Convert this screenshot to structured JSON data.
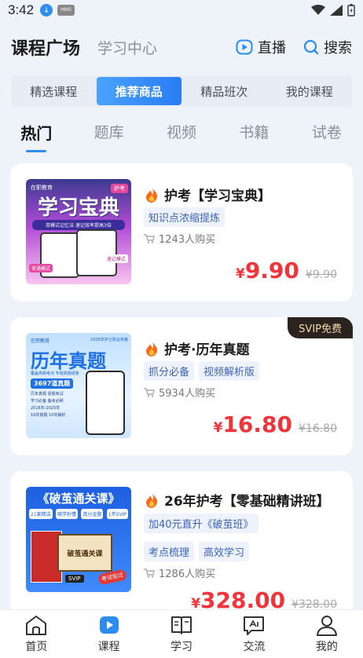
{
  "status": {
    "time": "3:42",
    "hms": "HMS"
  },
  "topbar": {
    "title": "课程广场",
    "subtitle": "学习中心",
    "live": "直播",
    "search": "搜索"
  },
  "segments": [
    "精选课程",
    "推荐商品",
    "精品班次",
    "我的课程"
  ],
  "active_segment": "推荐商品",
  "tabs": [
    "热门",
    "题库",
    "视频",
    "书籍",
    "试卷"
  ],
  "active_tab": "热门",
  "products": [
    {
      "title": "护考【学习宝典】",
      "tags": [
        "知识点浓缩提炼"
      ],
      "buyers": "1243人购买",
      "price_symbol": "¥",
      "price": "9.90",
      "original": "¥9.90",
      "cover": {
        "brand": "在职教育",
        "corner": "护考",
        "headline": "学习宝典",
        "ribbon": "双模式记忆法 速记效率提高3倍",
        "badge1": "背诵模式",
        "badge2": "速记模式"
      }
    },
    {
      "title": "护考·历年真题",
      "tags": [
        "抓分必备",
        "视频解析版"
      ],
      "buyers": "5934人购买",
      "price_symbol": "¥",
      "price": "16.80",
      "original": "¥16.80",
      "badge": "SVIP免费",
      "cover": {
        "brand": "在职教育",
        "top": "2026年护士执业资格",
        "headline": "历年真题",
        "sub": "覆盖高频考点 专题真题组卷",
        "count": "3697道真题",
        "lines": [
          "历年真题 逐题考试",
          "学习必备 备考必刷",
          "2016年-2025年",
          "10年真题 10年解析"
        ]
      }
    },
    {
      "title": "26年护考【零基础精讲班】",
      "tags": [
        "加40元直升《破茧班》",
        "考点梳理",
        "高效学习"
      ],
      "buyers": "1286人购买",
      "price_symbol": "¥",
      "price": "328.00",
      "original": "¥328.00",
      "cover": {
        "headline": "《破茧通关课》",
        "chips": [
          "21套精讲",
          "随学秒懂",
          "真分金题",
          "1年SVIP"
        ],
        "box": "破茧通关课",
        "svip": "SVIP",
        "stamp": "考试包过"
      }
    }
  ],
  "tabbar": [
    "首页",
    "课程",
    "学习",
    "交流",
    "我的"
  ],
  "active_nav": "课程",
  "colors": {
    "accent": "#2d8cf0",
    "price": "#f0343a"
  }
}
